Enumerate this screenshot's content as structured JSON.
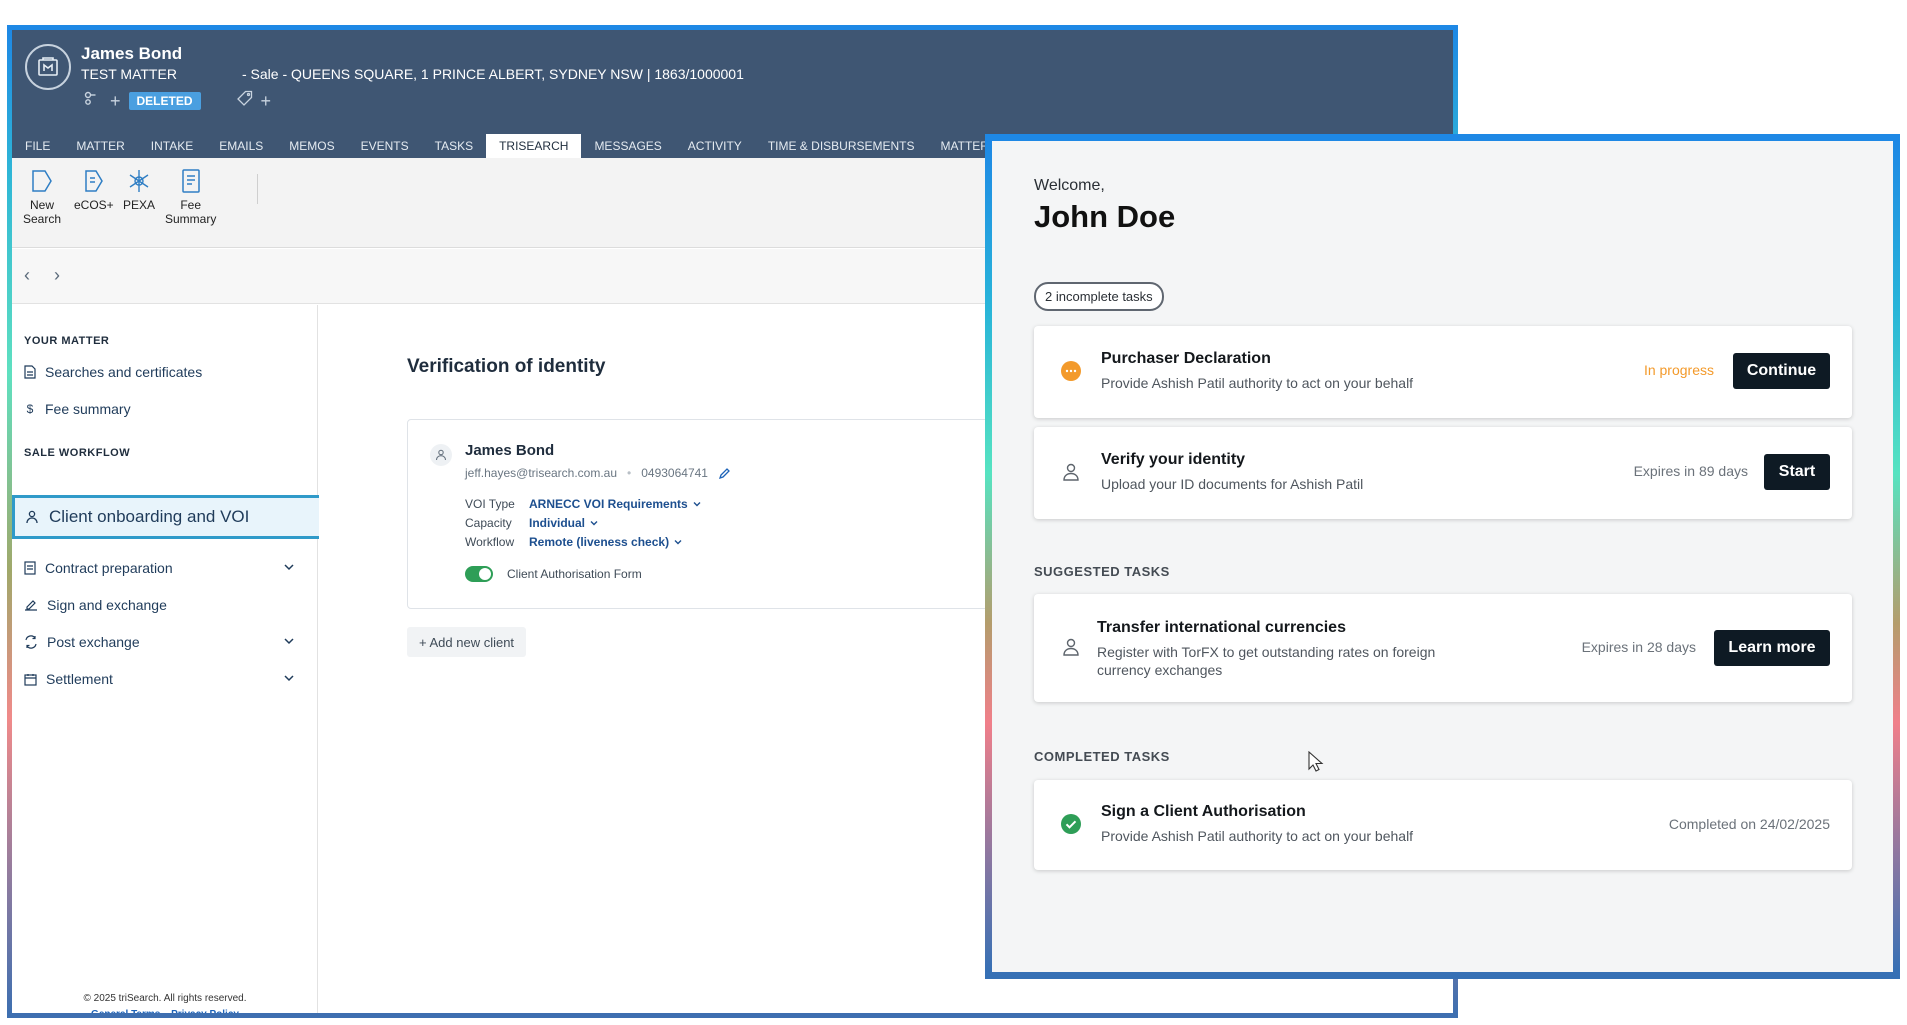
{
  "matter": {
    "client_name": "James Bond",
    "matter_type": "TEST MATTER",
    "description": "- Sale - QUEENS SQUARE, 1 PRINCE ALBERT, SYDNEY NSW | 1863/1000001",
    "status_badge": "DELETED"
  },
  "nav_tabs": [
    "FILE",
    "MATTER",
    "INTAKE",
    "EMAILS",
    "MEMOS",
    "EVENTS",
    "TASKS",
    "TRISEARCH",
    "MESSAGES",
    "ACTIVITY",
    "TIME & DISBURSEMENTS",
    "MATTER INSIGHTS"
  ],
  "active_tab": "TRISEARCH",
  "toolbar": {
    "new_search_1": "New",
    "new_search_2": "Search",
    "ecos": "eCOS+",
    "pexa": "PEXA",
    "fee_summary_1": "Fee",
    "fee_summary_2": "Summary"
  },
  "sidebar": {
    "your_matter_heading": "YOUR MATTER",
    "searches": "Searches and certificates",
    "fee_summary": "Fee summary",
    "sale_workflow_heading": "SALE WORKFLOW",
    "client_onboarding": "Client onboarding and VOI",
    "contract_preparation": "Contract preparation",
    "sign_and_exchange": "Sign and exchange",
    "post_exchange": "Post exchange",
    "settlement": "Settlement",
    "copyright": "© 2025 triSearch. All rights reserved.",
    "general_terms": "General Terms",
    "privacy_policy": "Privacy Policy"
  },
  "voi": {
    "title": "Verification of identity",
    "client": {
      "name": "James Bond",
      "email": "jeff.hayes@trisearch.com.au",
      "separator": "•",
      "phone": "0493064741",
      "voi_type_label": "VOI Type",
      "voi_type_value": "ARNECC VOI Requirements",
      "capacity_label": "Capacity",
      "capacity_value": "Individual",
      "workflow_label": "Workflow",
      "workflow_value": "Remote (liveness check)",
      "toggle_label": "Client Authorisation Form"
    },
    "add_client": "+ Add new client"
  },
  "portal": {
    "welcome": "Welcome,",
    "user_name": "John Doe",
    "incomplete_badge": "2 incomplete tasks",
    "tasks": [
      {
        "title": "Purchaser Declaration",
        "desc": "Provide Ashish Patil authority to act on your behalf",
        "status": "In progress",
        "button": "Continue"
      },
      {
        "title": "Verify your identity",
        "desc": "Upload your ID documents for Ashish Patil",
        "status": "Expires in 89 days",
        "button": "Start"
      }
    ],
    "suggested_heading": "SUGGESTED TASKS",
    "suggested": {
      "title": "Transfer international currencies",
      "desc_1": "Register with TorFX to get outstanding rates on foreign",
      "desc_2": "currency exchanges",
      "status": "Expires in 28 days",
      "button": "Learn more"
    },
    "completed_heading": "COMPLETED TASKS",
    "completed": {
      "title": "Sign a Client Authorisation",
      "desc": "Provide Ashish Patil authority to act on your behalf",
      "status": "Completed on 24/02/2025"
    },
    "colors": {
      "in_progress": "#f39a2b",
      "completed": "#2e9e57",
      "button": "#0e1a24"
    }
  }
}
